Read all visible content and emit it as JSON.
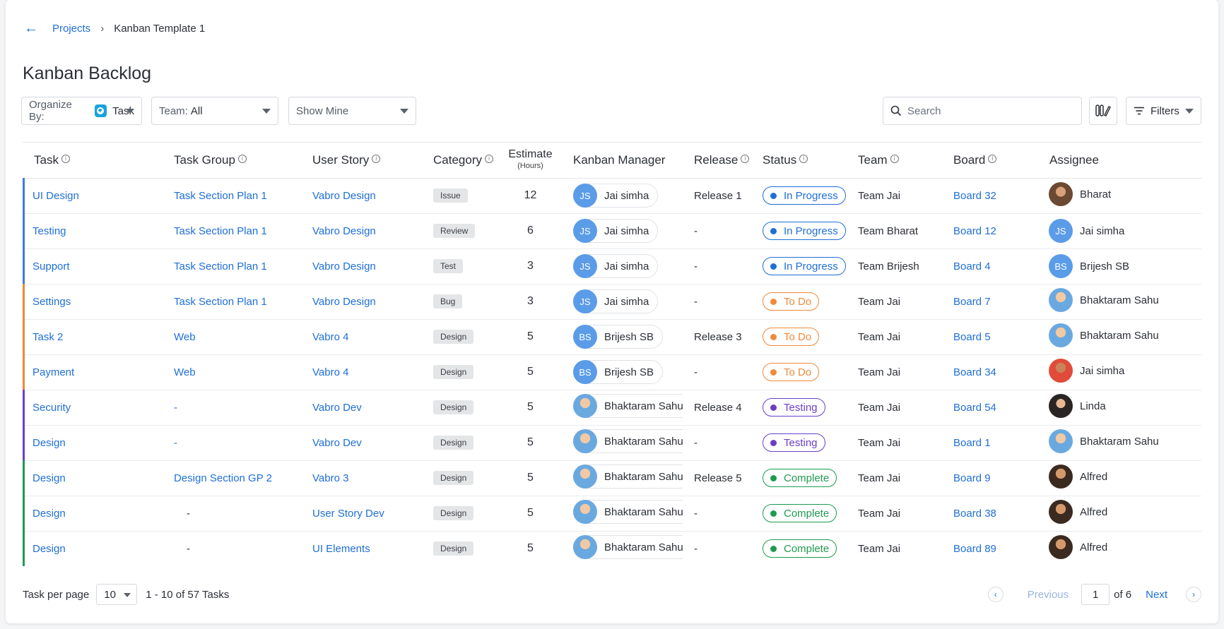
{
  "breadcrumb": {
    "root": "Projects",
    "current": "Kanban Template 1"
  },
  "page_title": "Kanban Backlog",
  "toolbar": {
    "organize_label": "Organize By:",
    "organize_value": "Task",
    "team_label": "Team:",
    "team_value": "All",
    "show_mine": "Show Mine",
    "search_placeholder": "Search",
    "filters_label": "Filters"
  },
  "columns": {
    "task": "Task",
    "task_group": "Task Group",
    "user_story": "User Story",
    "category": "Category",
    "estimate": "Estimate",
    "estimate_unit": "(Hours)",
    "kanban_manager": "Kanban Manager",
    "release": "Release",
    "status": "Status",
    "team": "Team",
    "board": "Board",
    "assignee": "Assignee"
  },
  "rows": [
    {
      "bar": "#3f7be0",
      "task": "UI Design",
      "group": "Task Section Plan 1",
      "story": "Vabro Design",
      "category": "Issue",
      "estimate": "12",
      "manager_initials": "JS",
      "manager": "Jai simha",
      "manager_photo": false,
      "release": "Release 1",
      "status": "In Progress",
      "status_cls": "st-progress",
      "team": "Team Jai",
      "board": "Board 32",
      "assignee_initials": "",
      "assignee": "Bharat",
      "assignee_photo": "av-photo5"
    },
    {
      "bar": "#3f7be0",
      "task": "Testing",
      "group": "Task Section Plan 1",
      "story": "Vabro Design",
      "category": "Review",
      "estimate": "6",
      "manager_initials": "JS",
      "manager": "Jai simha",
      "manager_photo": false,
      "release": "-",
      "status": "In Progress",
      "status_cls": "st-progress",
      "team": "Team Bharat",
      "board": "Board 12",
      "assignee_initials": "JS",
      "assignee": "Jai simha",
      "assignee_photo": ""
    },
    {
      "bar": "#3f7be0",
      "task": "Support",
      "group": "Task Section Plan 1",
      "story": "Vabro Design",
      "category": "Test",
      "estimate": "3",
      "manager_initials": "JS",
      "manager": "Jai simha",
      "manager_photo": false,
      "release": "-",
      "status": "In Progress",
      "status_cls": "st-progress",
      "team": "Team Brijesh",
      "board": "Board 4",
      "assignee_initials": "BS",
      "assignee": "Brijesh SB",
      "assignee_photo": ""
    },
    {
      "bar": "#ef8a3a",
      "task": "Settings",
      "group": "Task Section Plan 1",
      "story": "Vabro Design",
      "category": "Bug",
      "estimate": "3",
      "manager_initials": "JS",
      "manager": "Jai simha",
      "manager_photo": false,
      "release": "-",
      "status": "To Do",
      "status_cls": "st-todo",
      "team": "Team Jai",
      "board": "Board 7",
      "assignee_initials": "",
      "assignee": "Bhaktaram Sahu",
      "assignee_photo": "av-photo"
    },
    {
      "bar": "#ef8a3a",
      "task": "Task 2",
      "group": "Web",
      "story": "Vabro 4",
      "category": "Design",
      "estimate": "5",
      "manager_initials": "BS",
      "manager": "Brijesh SB",
      "manager_photo": false,
      "release": "Release 3",
      "status": "To Do",
      "status_cls": "st-todo",
      "team": "Team Jai",
      "board": "Board 5",
      "assignee_initials": "",
      "assignee": "Bhaktaram Sahu",
      "assignee_photo": "av-photo"
    },
    {
      "bar": "#ef8a3a",
      "task": "Payment",
      "group": "Web",
      "story": "Vabro 4",
      "category": "Design",
      "estimate": "5",
      "manager_initials": "BS",
      "manager": "Brijesh SB",
      "manager_photo": false,
      "release": "-",
      "status": "To Do",
      "status_cls": "st-todo",
      "team": "Team Jai",
      "board": "Board 34",
      "assignee_initials": "",
      "assignee": "Jai simha",
      "assignee_photo": "av-photo3"
    },
    {
      "bar": "#6a3fc7",
      "task": "Security",
      "group": "-",
      "story": "Vabro Dev",
      "category": "Design",
      "estimate": "5",
      "manager_initials": "",
      "manager": "Bhaktaram Sahu",
      "manager_photo": true,
      "release": "Release 4",
      "status": "Testing",
      "status_cls": "st-testing",
      "team": "Team Jai",
      "board": "Board 54",
      "assignee_initials": "",
      "assignee": "Linda",
      "assignee_photo": "av-photo4"
    },
    {
      "bar": "#6a3fc7",
      "task": "Design",
      "group": "-",
      "story": "Vabro Dev",
      "category": "Design",
      "estimate": "5",
      "manager_initials": "",
      "manager": "Bhaktaram Sahu",
      "manager_photo": true,
      "release": "-",
      "status": "Testing",
      "status_cls": "st-testing",
      "team": "Team Jai",
      "board": "Board 1",
      "assignee_initials": "",
      "assignee": "Bhaktaram Sahu",
      "assignee_photo": "av-photo"
    },
    {
      "bar": "#1e9b4f",
      "task": "Design",
      "group": "Design Section GP 2",
      "story": "Vabro 3",
      "category": "Design",
      "estimate": "5",
      "manager_initials": "",
      "manager": "Bhaktaram Sahu",
      "manager_photo": true,
      "release": "Release 5",
      "status": "Complete",
      "status_cls": "st-complete",
      "team": "Team Jai",
      "board": "Board 9",
      "assignee_initials": "",
      "assignee": "Alfred",
      "assignee_photo": "av-photo2"
    },
    {
      "bar": "#1e9b4f",
      "task": "Design",
      "group": "-",
      "story": "User Story Dev",
      "category": "Design",
      "estimate": "5",
      "manager_initials": "",
      "manager": "Bhaktaram Sahu",
      "manager_photo": true,
      "release": "-",
      "status": "Complete",
      "status_cls": "st-complete",
      "team": "Team Jai",
      "board": "Board 38",
      "assignee_initials": "",
      "assignee": "Alfred",
      "assignee_photo": "av-photo2"
    },
    {
      "bar": "#1e9b4f",
      "task": "Design",
      "group": "-",
      "story": "UI Elements",
      "category": "Design",
      "estimate": "5",
      "manager_initials": "",
      "manager": "Bhaktaram Sahu",
      "manager_photo": true,
      "release": "-",
      "status": "Complete",
      "status_cls": "st-complete",
      "team": "Team Jai",
      "board": "Board 89",
      "assignee_initials": "",
      "assignee": "Alfred",
      "assignee_photo": "av-photo2"
    }
  ],
  "footer": {
    "per_page_label": "Task per page",
    "per_page_value": "10",
    "range": "1 - 10 of 57 Tasks",
    "previous": "Previous",
    "page_value": "1",
    "of_pages": "of 6",
    "next": "Next"
  }
}
